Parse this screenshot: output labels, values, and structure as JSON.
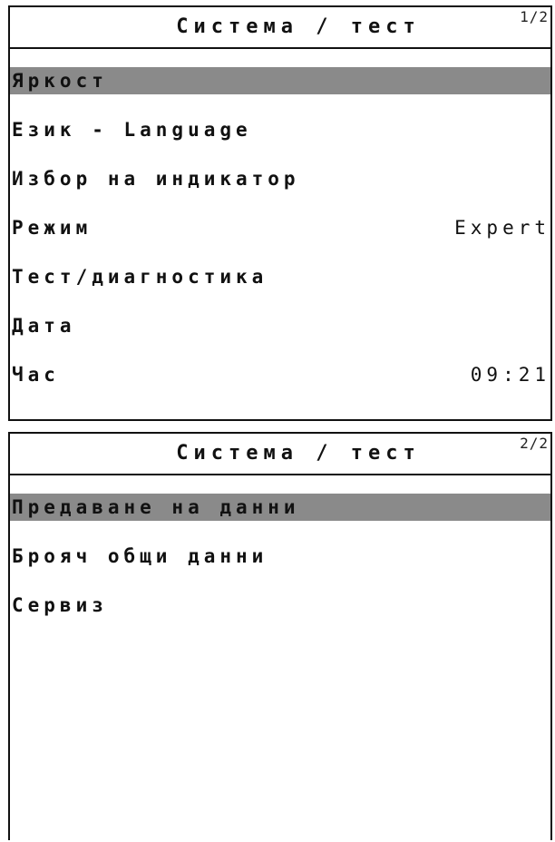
{
  "panel1": {
    "title": "Система / тест",
    "page": "1/2",
    "items": [
      {
        "label": "Яркост",
        "value": ""
      },
      {
        "label": "Език",
        "label_suffix": " - Language",
        "value": ""
      },
      {
        "label": "Избор на индикатор",
        "value": ""
      },
      {
        "label": "Режим",
        "value": "Expert"
      },
      {
        "label": "Тест/диагностика",
        "value": ""
      },
      {
        "label": "Дата",
        "value": ""
      },
      {
        "label": "Час",
        "value": "09:21"
      }
    ]
  },
  "panel2": {
    "title": "Система / тест",
    "page": "2/2",
    "items": [
      {
        "label": "Предаване на данни"
      },
      {
        "label": "Брояч общи данни"
      },
      {
        "label": "Сервиз"
      }
    ]
  },
  "colors": {
    "selection": "#8a8a8a",
    "border": "#111111",
    "background": "#ffffff"
  }
}
